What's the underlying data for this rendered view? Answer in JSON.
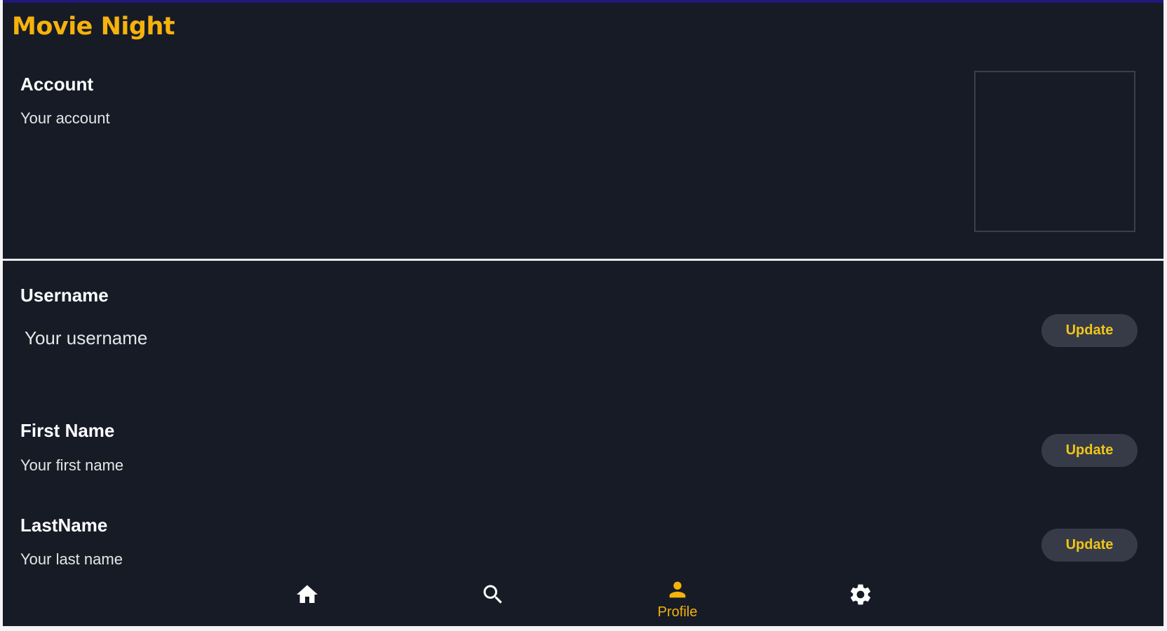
{
  "app": {
    "title": "Movie Night"
  },
  "account": {
    "heading": "Account",
    "subtitle": "Your account"
  },
  "fields": [
    {
      "label": "Username",
      "value": "Your username",
      "button": "Update"
    },
    {
      "label": "First Name",
      "value": "Your first name",
      "button": "Update"
    },
    {
      "label": "LastName",
      "value": "Your last name",
      "button": "Update"
    }
  ],
  "nav": {
    "items": [
      {
        "icon": "home-icon",
        "label": ""
      },
      {
        "icon": "search-icon",
        "label": ""
      },
      {
        "icon": "person-icon",
        "label": "Profile",
        "active": true
      },
      {
        "icon": "gear-icon",
        "label": ""
      }
    ]
  },
  "colors": {
    "background": "#161b26",
    "accent": "#f6b20c",
    "button_bg": "#363b47",
    "button_text": "#f0c419",
    "top_bar": "#23167a"
  }
}
